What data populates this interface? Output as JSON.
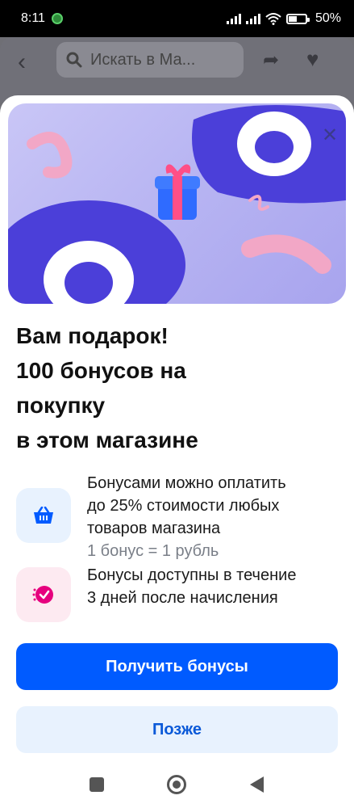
{
  "status_bar": {
    "time": "8:11",
    "battery": "50%"
  },
  "app_bar": {
    "search_placeholder": "Искать в Ма..."
  },
  "gift_sheet": {
    "title_lines": [
      "Вам подарок!",
      "100 бонусов на",
      "покупку",
      "в этом магазине"
    ],
    "features": [
      {
        "icon": "basket-icon",
        "lines": [
          "Бонусами можно оплатить",
          "до 25% стоимости любых",
          "товаров магазина"
        ],
        "note": "1 бонус = 1 рубль"
      },
      {
        "icon": "timer-check-icon",
        "lines": [
          "Бонусы доступны в течение",
          "3 дней после начисления"
        ]
      }
    ],
    "primary_button": "Получить бонусы",
    "secondary_button": "Позже"
  },
  "colors": {
    "accent": "#005bff",
    "secondary_bg": "#e8f2fe",
    "banner_bg": "#b7b4f2"
  }
}
